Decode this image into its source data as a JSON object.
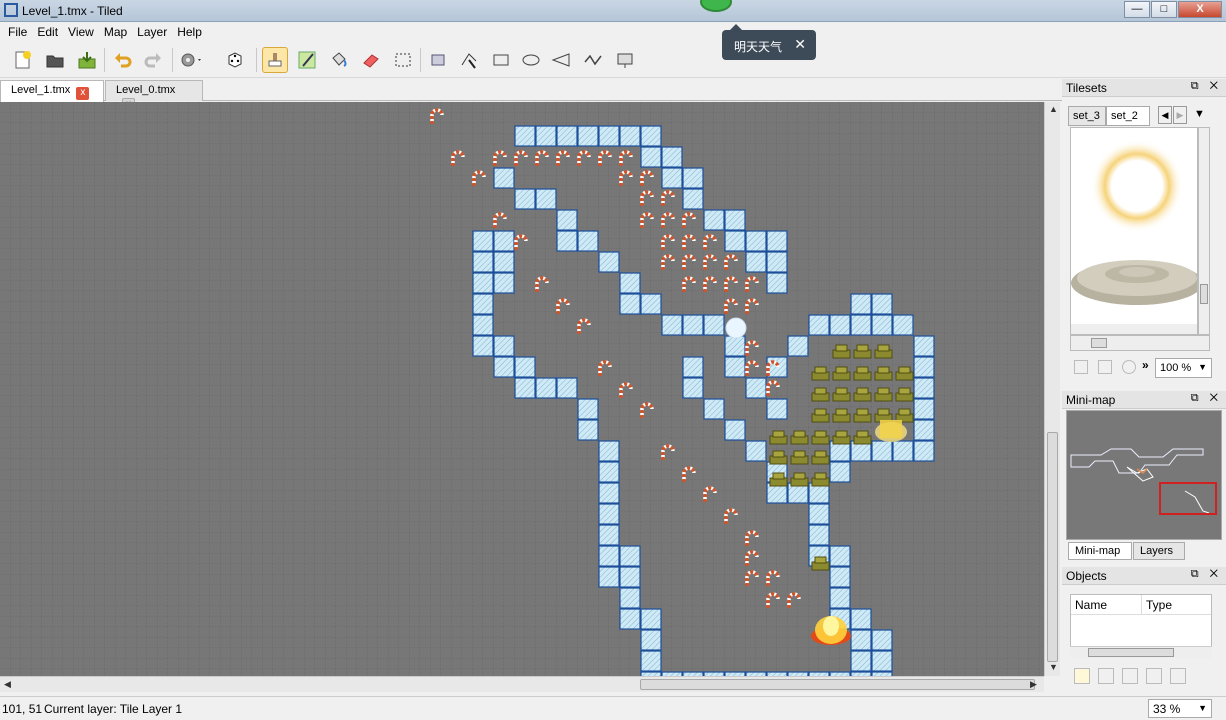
{
  "window": {
    "title": "Level_1.tmx - Tiled",
    "minimize": "—",
    "maximize": "□",
    "close": "X"
  },
  "menu": [
    "File",
    "Edit",
    "View",
    "Map",
    "Layer",
    "Help"
  ],
  "tooltip": {
    "text": "明天天气",
    "close": "✕"
  },
  "tabs": [
    {
      "label": "Level_1.tmx",
      "close": "x",
      "active": true
    },
    {
      "label": "Level_0.tmx",
      "close": "x",
      "active": false
    }
  ],
  "tilesets": {
    "title": "Tilesets",
    "panel_buttons": "⧉ ✕",
    "tabs": [
      "set_3",
      "set_2"
    ],
    "zoom": "100 %"
  },
  "minimap": {
    "title": "Mini-map",
    "panel_buttons": "⧉ ✕"
  },
  "panel_tabs": [
    "Mini-map",
    "Layers"
  ],
  "objects": {
    "title": "Objects",
    "panel_buttons": "⧉ ✕",
    "columns": [
      "Name",
      "Type"
    ]
  },
  "status": {
    "coords": "101, 51",
    "current_layer": "Current layer: Tile Layer 1",
    "zoom": "33 %"
  },
  "icons": {
    "toolbar": [
      "new-map-icon",
      "open-icon",
      "save-icon",
      "undo-icon",
      "redo-icon",
      "command-icon",
      "random-mode-icon",
      "stamp-brush-icon",
      "terrain-brush-icon",
      "bucket-fill-icon",
      "eraser-icon",
      "rectangle-select-icon",
      "select-objects-icon",
      "edit-polygons-icon",
      "insert-rectangle-icon",
      "insert-ellipse-icon",
      "insert-polygon-icon",
      "insert-polyline-icon",
      "insert-tile-icon"
    ]
  },
  "colors": {
    "canvas_bg": "#777777",
    "ice_tile": "#c9e6f3",
    "ice_border": "#1d4f9a",
    "candy_cane": "#d0542a",
    "accent_close": "#e0533a"
  }
}
